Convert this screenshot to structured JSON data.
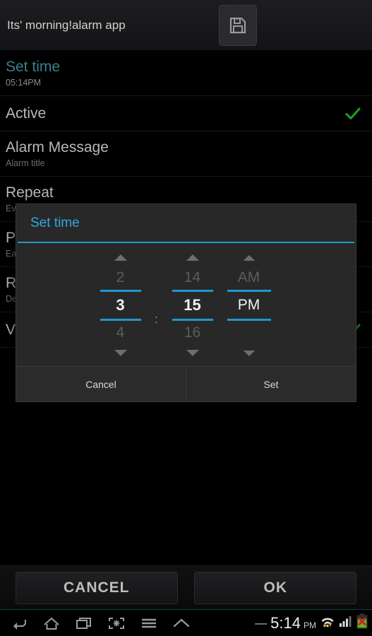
{
  "header": {
    "app_title": "Its' morning!alarm app",
    "save_icon": "save-floppy-icon"
  },
  "settings_rows": [
    {
      "title": "Set time",
      "subtitle": "05:14PM",
      "accent": true,
      "checked": false
    },
    {
      "title": "Active",
      "subtitle": "",
      "accent": false,
      "checked": true
    },
    {
      "title": "Alarm Message",
      "subtitle": "Alarm title",
      "accent": false,
      "checked": false
    },
    {
      "title": "Repeat",
      "subtitle": "Every Day",
      "accent": false,
      "checked": false
    },
    {
      "title": "Puzzle",
      "subtitle": "Easy",
      "accent": false,
      "checked": false
    },
    {
      "title": "Ringtone",
      "subtitle": "Default",
      "accent": false,
      "checked": false
    },
    {
      "title": "Vibrate",
      "subtitle": "",
      "accent": false,
      "checked": true
    }
  ],
  "dialog": {
    "title": "Set time",
    "hour": {
      "prev": "2",
      "current": "3",
      "next": "4"
    },
    "minute": {
      "prev": "14",
      "current": "15",
      "next": "16"
    },
    "ampm": {
      "prev": "AM",
      "current": "PM",
      "next": ""
    },
    "separator": ":",
    "cancel_label": "Cancel",
    "set_label": "Set"
  },
  "action_bar": {
    "cancel_label": "CANCEL",
    "ok_label": "OK"
  },
  "navbar": {
    "icons": [
      "back-icon",
      "home-icon",
      "recents-icon",
      "screenshot-icon",
      "menu-icon",
      "chevron-up-icon"
    ],
    "status": {
      "dash": "—",
      "time": "5:14",
      "ampm": "PM",
      "wifi_icon": "wifi-icon",
      "signal_icon": "signal-bars-icon",
      "battery_icon": "battery-error-icon"
    }
  },
  "colors": {
    "accent_blue": "#2196cf",
    "dim_teal": "#3b7f8c",
    "check_green": "#1f9e22",
    "battery_green": "#5eb82a",
    "battery_error_red": "#d32020"
  }
}
